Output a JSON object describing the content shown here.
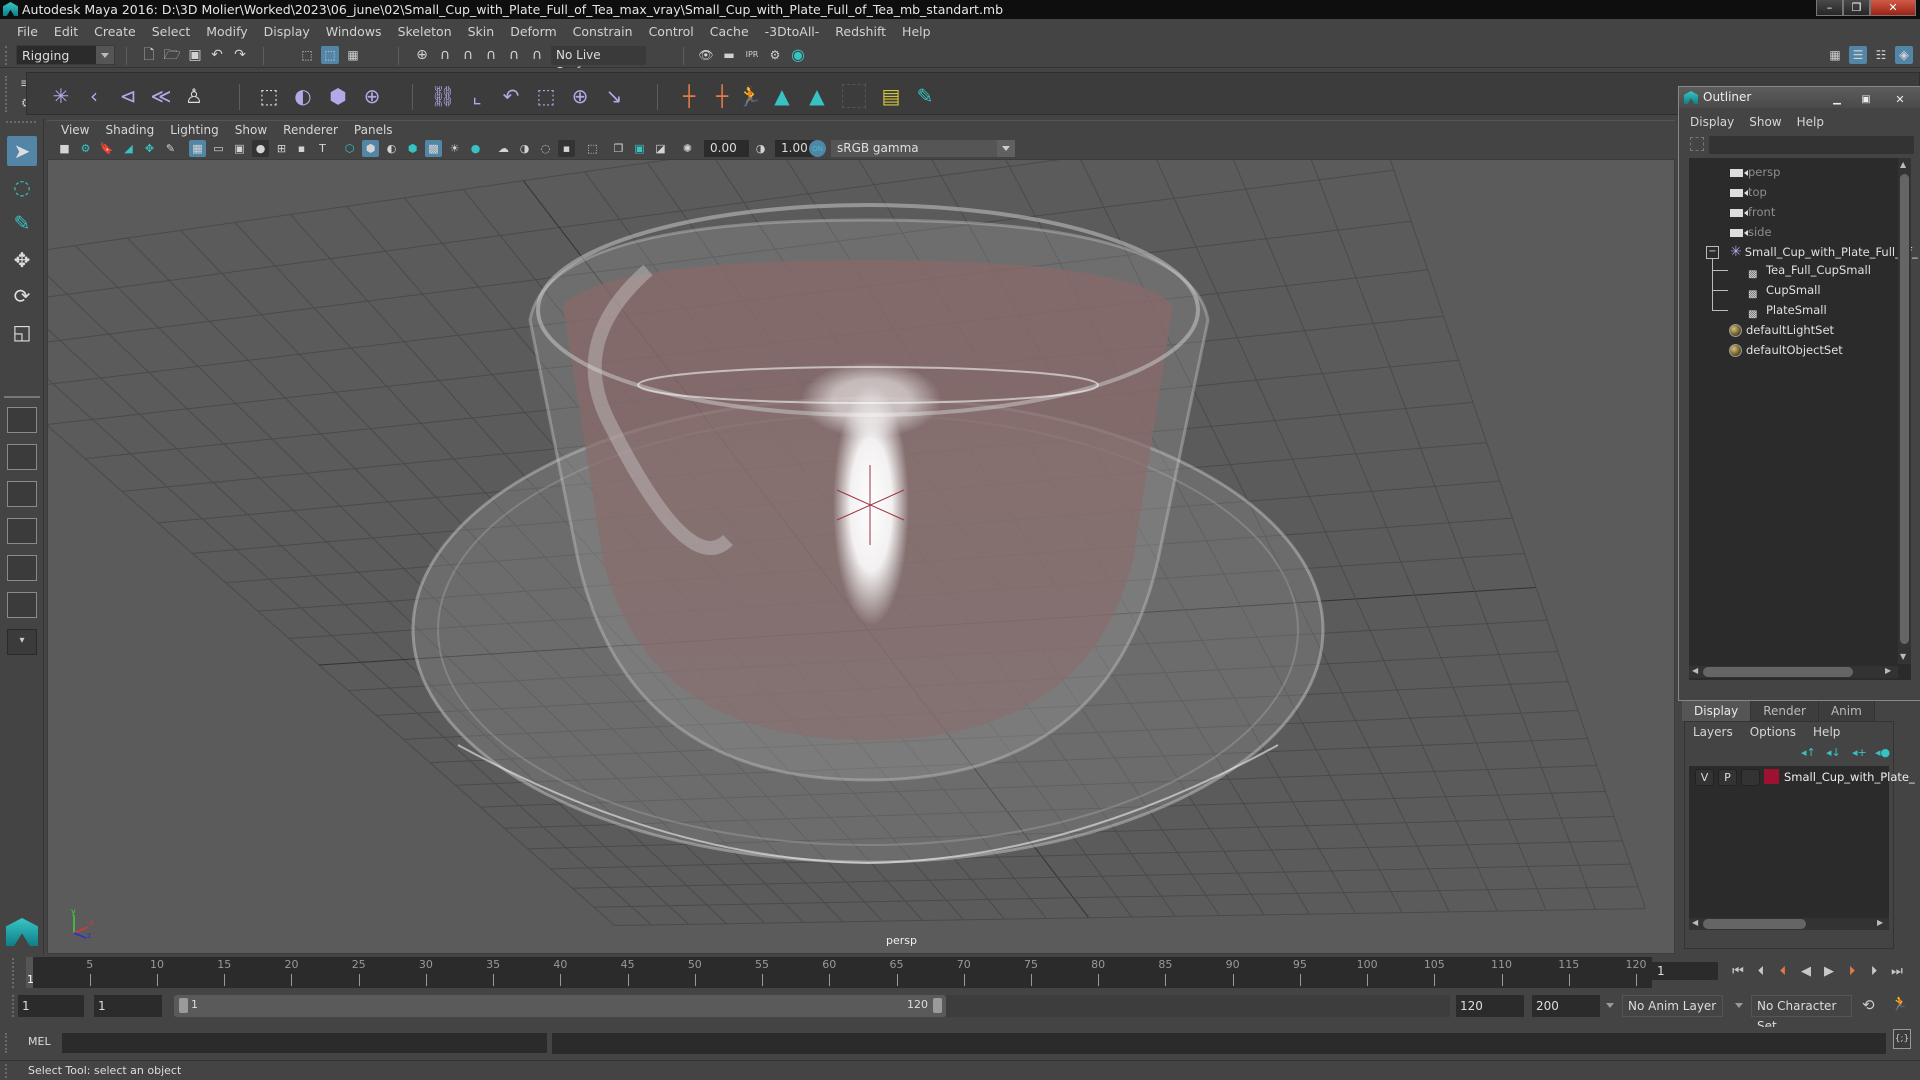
{
  "window": {
    "title": "Autodesk Maya 2016: D:\\3D Molier\\Worked\\2023\\06_june\\02\\Small_Cup_with_Plate_Full_of_Tea_max_vray\\Small_Cup_with_Plate_Full_of_Tea_mb_standart.mb",
    "controls": {
      "minimize": "–",
      "restore": "❐",
      "close": "✕"
    }
  },
  "menubar": [
    "File",
    "Edit",
    "Create",
    "Select",
    "Modify",
    "Display",
    "Windows",
    "Skeleton",
    "Skin",
    "Deform",
    "Constrain",
    "Control",
    "Cache",
    "-3DtoAll-",
    "Redshift",
    "Help"
  ],
  "statusline": {
    "mode": "Rigging",
    "live_surface": "No Live Surface",
    "icons": [
      "new-scene-icon",
      "open-scene-icon",
      "save-scene-icon",
      "undo-icon",
      "redo-icon",
      "select-hierarchy-icon",
      "select-object-icon",
      "select-component-icon",
      "snap-grid-icon",
      "snap-curve-icon",
      "snap-point-icon",
      "snap-view-plane-icon",
      "snap-surface-icon",
      "make-live-icon",
      "render-view-icon",
      "render-frame-icon",
      "ipr-render-icon",
      "render-settings-icon",
      "hypershade-icon"
    ],
    "right_icons": [
      "modeling-toolkit-icon",
      "attribute-editor-icon",
      "tool-settings-icon",
      "channel-box-icon"
    ]
  },
  "shelf": {
    "groups": [
      [
        "joint-tool-icon",
        "ik-handle-icon",
        "ik-spline-icon",
        "bind-skin-icon",
        "humanik-icon"
      ],
      [
        "paint-weights-icon",
        "deformer-icon",
        "lattice-icon",
        "cluster-icon"
      ],
      [
        "parent-constraint-icon",
        "point-constraint-icon",
        "orient-constraint-icon",
        "scale-constraint-icon",
        "aim-constraint-icon",
        "pole-vector-icon"
      ],
      [
        "locator-icon",
        "parent-locator-icon",
        "character-icon",
        "maya-logo-icon",
        "maya-logo-icon-2",
        "empty-slot",
        "set-display-icon",
        "paint-select-icon"
      ]
    ]
  },
  "toolbox": {
    "tools": [
      "select-tool-icon",
      "lasso-tool-icon",
      "paint-select-tool-icon",
      "move-tool-icon",
      "rotate-tool-icon",
      "scale-tool-icon"
    ],
    "layouts": [
      "single-perspective-layout",
      "four-view-layout",
      "persp-outliner-layout",
      "persp-graph-layout",
      "persp-hypershade-layout",
      "persp-graph-outliner-layout",
      "more-layouts"
    ]
  },
  "viewport": {
    "menu": [
      "View",
      "Shading",
      "Lighting",
      "Show",
      "Renderer",
      "Panels"
    ],
    "exposure": "0.00",
    "gamma": "1.00",
    "color_management": "ON",
    "color_space": "sRGB gamma",
    "camera_label": "persp",
    "axis": {
      "x": "x",
      "y": "y",
      "z": "z"
    }
  },
  "outliner": {
    "title": "Outliner",
    "menu": [
      "Display",
      "Show",
      "Help"
    ],
    "search_value": "",
    "items": [
      {
        "label": "persp",
        "type": "camera",
        "dim": true
      },
      {
        "label": "top",
        "type": "camera",
        "dim": true
      },
      {
        "label": "front",
        "type": "camera",
        "dim": true
      },
      {
        "label": "side",
        "type": "camera",
        "dim": true
      },
      {
        "label": "Small_Cup_with_Plate_Full_of_",
        "type": "group",
        "expanded": true
      },
      {
        "label": "Tea_Full_CupSmall",
        "type": "mesh",
        "child": true
      },
      {
        "label": "CupSmall",
        "type": "mesh",
        "child": true
      },
      {
        "label": "PlateSmall",
        "type": "mesh",
        "child": true
      },
      {
        "label": "defaultLightSet",
        "type": "set"
      },
      {
        "label": "defaultObjectSet",
        "type": "set"
      }
    ]
  },
  "layer_editor": {
    "tabs": [
      "Display",
      "Render",
      "Anim"
    ],
    "active_tab": "Display",
    "menu": [
      "Layers",
      "Options",
      "Help"
    ],
    "layers": [
      {
        "visible": "V",
        "playback": "P",
        "name": "Small_Cup_with_Plate_",
        "color": "#9c1230"
      }
    ]
  },
  "timeline": {
    "ticks": [
      5,
      10,
      15,
      20,
      25,
      30,
      35,
      40,
      45,
      50,
      55,
      60,
      65,
      70,
      75,
      80,
      85,
      90,
      95,
      100,
      105,
      110,
      115,
      120
    ],
    "range": [
      1,
      120
    ],
    "current_frame": "1",
    "current_frame_field": "1",
    "playback_buttons": [
      "go-to-start-icon",
      "step-back-key-icon",
      "step-back-frame-icon",
      "play-backwards-icon",
      "play-forwards-icon",
      "step-forward-frame-icon",
      "step-forward-key-icon",
      "go-to-end-icon"
    ]
  },
  "range_slider": {
    "start_time": "1",
    "playback_start": "1",
    "slider_start_label": "1",
    "slider_end_label": "120",
    "playback_end": "120",
    "end_time": "200",
    "anim_layer": "No Anim Layer",
    "character_set": "No Character Set"
  },
  "command_line": {
    "label": "MEL",
    "input": "",
    "output": ""
  },
  "help_line": "Select Tool: select an object",
  "colors": {
    "accent_blue": "#5285a6",
    "teal": "#37c2c4",
    "constraint_purple": "#b5a8e8",
    "locator_orange": "#e27b45",
    "layer_color": "#9c1230"
  }
}
